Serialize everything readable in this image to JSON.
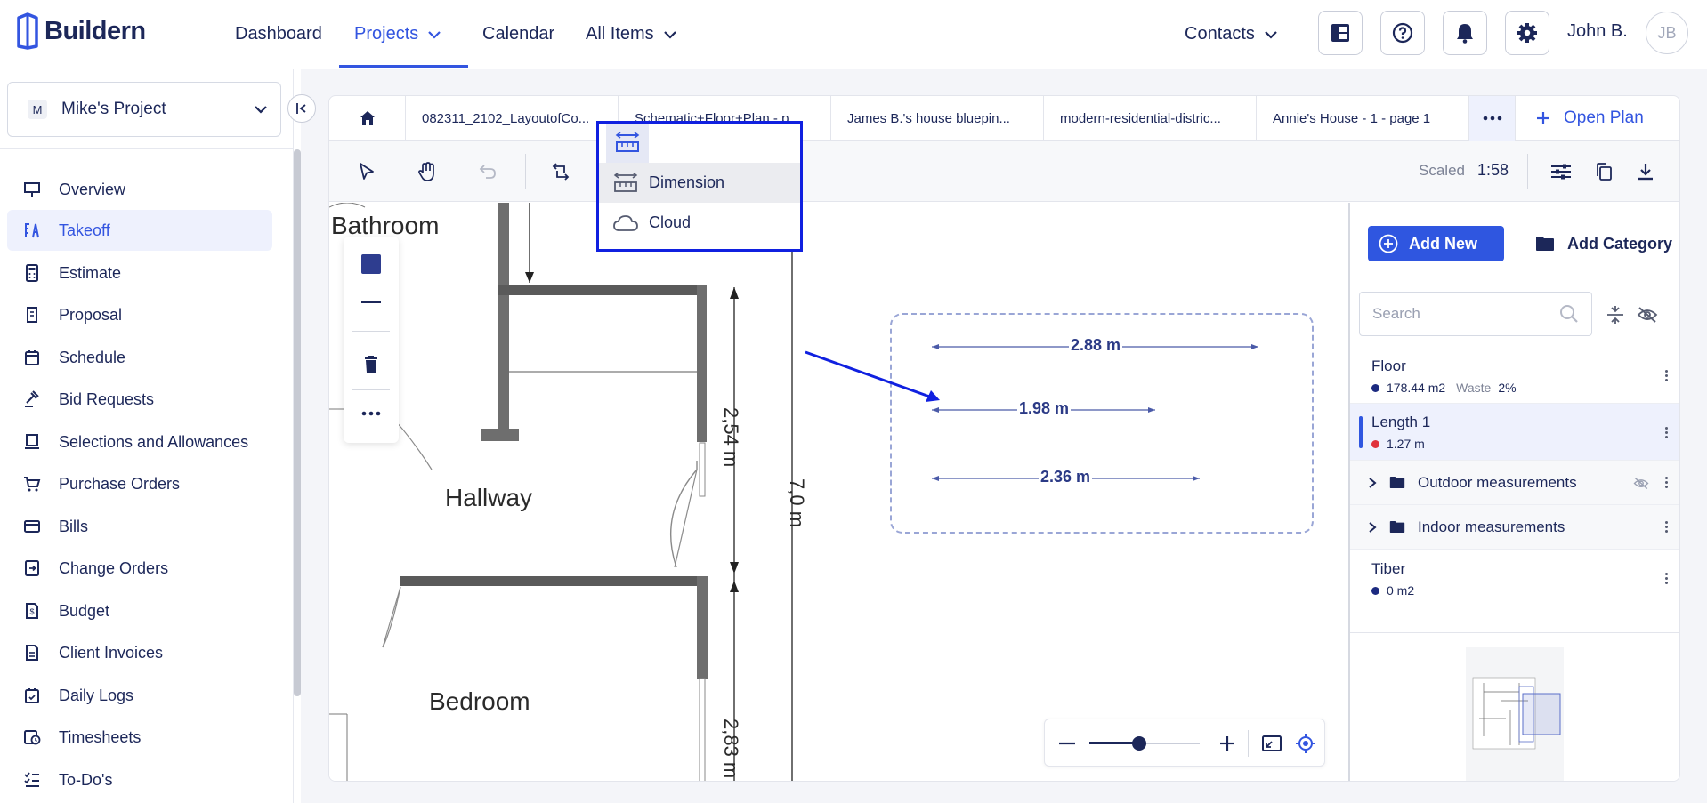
{
  "header": {
    "logo_text": "Buildern",
    "nav": {
      "dashboard": "Dashboard",
      "projects": "Projects",
      "calendar": "Calendar",
      "all_items": "All Items",
      "contacts": "Contacts"
    },
    "user_name": "John B.",
    "avatar_initials": "JB"
  },
  "sidebar": {
    "project_badge": "M",
    "project_name": "Mike's Project",
    "items": [
      {
        "label": "Overview",
        "icon": "presentation-icon"
      },
      {
        "label": "Takeoff",
        "icon": "takeoff-icon"
      },
      {
        "label": "Estimate",
        "icon": "calculator-icon"
      },
      {
        "label": "Proposal",
        "icon": "proposal-icon"
      },
      {
        "label": "Schedule",
        "icon": "calendar-icon"
      },
      {
        "label": "Bid Requests",
        "icon": "gavel-icon"
      },
      {
        "label": "Selections and Allowances",
        "icon": "selection-icon"
      },
      {
        "label": "Purchase Orders",
        "icon": "cart-icon"
      },
      {
        "label": "Bills",
        "icon": "bill-icon"
      },
      {
        "label": "Change Orders",
        "icon": "change-order-icon"
      },
      {
        "label": "Budget",
        "icon": "budget-icon"
      },
      {
        "label": "Client Invoices",
        "icon": "invoice-icon"
      },
      {
        "label": "Daily Logs",
        "icon": "daily-log-icon"
      },
      {
        "label": "Timesheets",
        "icon": "timesheet-icon"
      },
      {
        "label": "To-Do's",
        "icon": "todo-icon"
      }
    ],
    "active_item": "Takeoff"
  },
  "tabs": {
    "items": [
      "082311_2102_LayoutofCo...",
      "Schematic+Floor+Plan - p...",
      "James B.'s house bluepin...",
      "modern-residential-distric...",
      "Annie's House - 1 - page 1"
    ],
    "open_plan": "Open Plan"
  },
  "toolbar": {
    "scale_label": "Scaled",
    "scale_value": "1:58"
  },
  "dropdown": {
    "items": [
      "Dimension",
      "Cloud"
    ],
    "hovered": "Dimension"
  },
  "plan": {
    "rooms": [
      "Bathroom",
      "Hallway",
      "Bedroom"
    ],
    "dimensions": [
      "2,54 m",
      "7,0 m",
      "2,83 m"
    ],
    "cloud_measurements": [
      "2.88 m",
      "1.98 m",
      "2.36 m"
    ]
  },
  "right_panel": {
    "add_new": "Add New",
    "add_category": "Add Category",
    "search_placeholder": "Search",
    "items": [
      {
        "title": "Floor",
        "value": "178.44 m2",
        "waste_label": "Waste",
        "waste_value": "2%",
        "dot_color": "#1c2a80"
      },
      {
        "title": "Length 1",
        "value": "1.27 m",
        "dot_color": "#e0323c"
      }
    ],
    "folders": [
      "Outdoor measurements",
      "Indoor measurements"
    ],
    "last_item": {
      "title": "Tiber",
      "value": "0 m2",
      "dot_color": "#1c2a80"
    }
  },
  "colors": {
    "accent": "#3355e0",
    "highlight_box": "#1020e0",
    "navy": "#1c2759"
  }
}
